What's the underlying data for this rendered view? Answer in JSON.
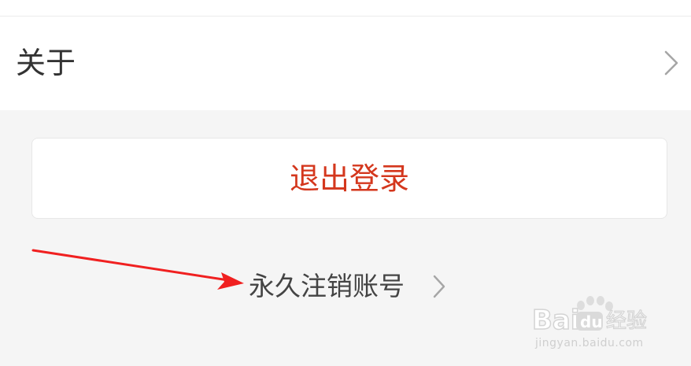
{
  "settings": {
    "about_label": "关于"
  },
  "actions": {
    "logout_label": "退出登录",
    "delete_account_label": "永久注销账号"
  },
  "watermark": {
    "logo_text": "Baidu经验",
    "url": "jingyan.baidu.com"
  },
  "colors": {
    "logout_text": "#d4371d",
    "annotation_arrow": "#f02020",
    "background": "#f5f5f5"
  },
  "icons": {
    "about_chevron": "chevron-right-icon",
    "delete_chevron": "chevron-right-icon",
    "annotation": "red-arrow-icon",
    "watermark": "baidu-paw-logo"
  }
}
